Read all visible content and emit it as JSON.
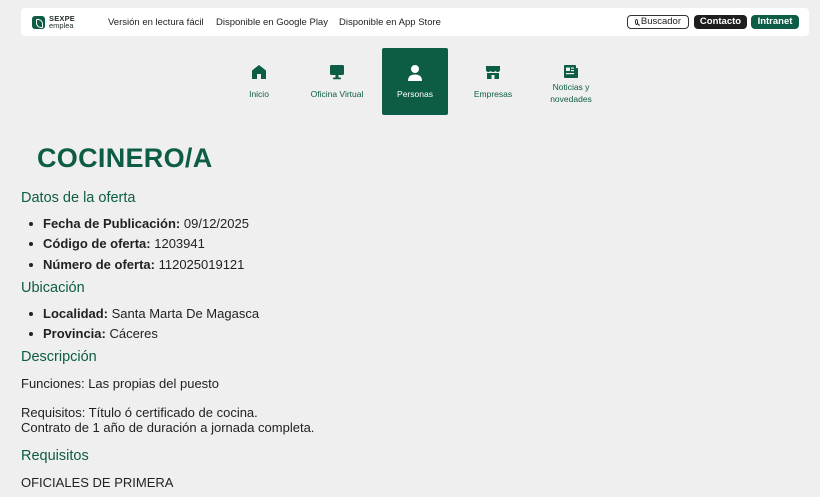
{
  "header": {
    "logo": {
      "line1": "SEXPE",
      "line2": "emplea"
    },
    "links": [
      "Versión en lectura fácil",
      "Disponible en Google Play",
      "Disponible en App Store"
    ],
    "search_label": "Buscador",
    "contact_label": "Contacto",
    "intranet_label": "Intranet",
    "brand_color": "#0d5c45"
  },
  "nav": {
    "items": [
      {
        "label": "Inicio",
        "icon": "home-icon"
      },
      {
        "label": "Oficina Virtual",
        "icon": "monitor-icon"
      },
      {
        "label": "Personas",
        "icon": "person-icon",
        "active": true
      },
      {
        "label": "Empresas",
        "icon": "store-icon"
      },
      {
        "label_line1": "Noticias y",
        "label_line2": "novedades",
        "icon": "newspaper-icon"
      }
    ]
  },
  "offer": {
    "title": "COCINERO/A",
    "datos_heading": "Datos de la oferta",
    "fecha_label": "Fecha de Publicación:",
    "fecha_value": "09/12/2025",
    "codigo_label": "Código de oferta:",
    "codigo_value": "1203941",
    "numero_label": "Número de oferta:",
    "numero_value": "112025019121",
    "ubicacion_heading": "Ubicación",
    "localidad_label": "Localidad:",
    "localidad_value": "Santa Marta De Magasca",
    "provincia_label": "Provincia:",
    "provincia_value": "Cáceres",
    "descripcion_heading": "Descripción",
    "funciones": "Funciones: Las propias del puesto",
    "requisitos_line1": "Requisitos: Título ó certificado de cocina.",
    "requisitos_line2": "Contrato de 1 año de duración a jornada completa.",
    "requisitos_heading": "Requisitos",
    "requisitos_value": "OFICIALES DE PRIMERA"
  }
}
